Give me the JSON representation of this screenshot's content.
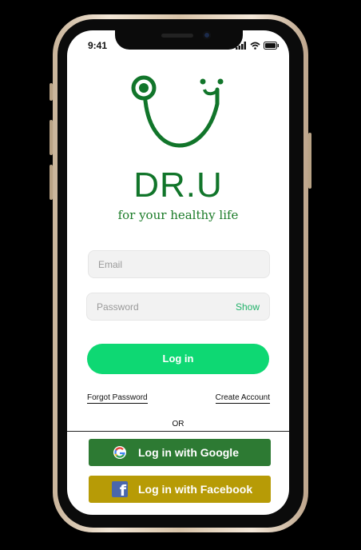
{
  "status_bar": {
    "time": "9:41",
    "icons": [
      "signal-icon",
      "wifi-icon",
      "battery-icon"
    ]
  },
  "brand": {
    "logo_icon": "stethoscope-icon",
    "name": "DR.U",
    "tagline": "for your healthy life",
    "color": "#11752a"
  },
  "form": {
    "email_placeholder": "Email",
    "email_value": "",
    "password_placeholder": "Password",
    "password_value": "",
    "show_label": "Show",
    "login_label": "Log in",
    "forgot_label": "Forgot Password",
    "create_label": "Create Account"
  },
  "divider": {
    "or_label": "OR"
  },
  "social": {
    "google_label": "Log in with Google",
    "google_icon": "google-icon",
    "google_color": "#2d7a33",
    "facebook_label": "Log in with Facebook",
    "facebook_icon": "facebook-icon",
    "facebook_color": "#b79b06"
  }
}
